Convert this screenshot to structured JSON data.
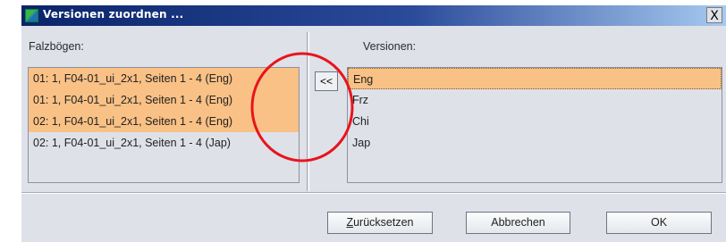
{
  "window": {
    "title": "Versionen zuordnen ...",
    "close_label": "X"
  },
  "left_panel": {
    "label": "Falzbögen:",
    "items": [
      {
        "text": "01: 1, F04-01_ui_2x1, Seiten 1 - 4 (Eng)",
        "selected": true
      },
      {
        "text": "01: 1, F04-01_ui_2x1, Seiten 1 - 4 (Eng)",
        "selected": true
      },
      {
        "text": "02: 1, F04-01_ui_2x1, Seiten 1 - 4 (Eng)",
        "selected": true
      },
      {
        "text": "02: 1, F04-01_ui_2x1, Seiten 1 - 4 (Jap)",
        "selected": false
      }
    ]
  },
  "assign_button": {
    "label": "<<"
  },
  "right_panel": {
    "label": "Versionen:",
    "items": [
      {
        "text": "Eng",
        "selected": true
      },
      {
        "text": "Frz",
        "selected": false
      },
      {
        "text": "Chi",
        "selected": false
      },
      {
        "text": "Jap",
        "selected": false
      }
    ]
  },
  "buttons": {
    "reset_underline": "Z",
    "reset_rest": "urücksetzen",
    "cancel": "Abbrechen",
    "ok": "OK"
  },
  "colors": {
    "selection": "#f9c185",
    "annotation": "#e8141c",
    "titlebar": "#0a246a"
  }
}
